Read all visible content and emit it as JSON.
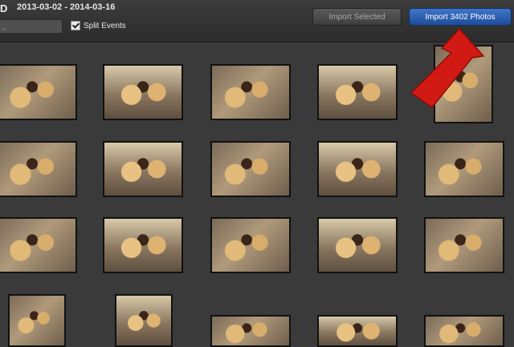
{
  "toolbar": {
    "title_fragment": "D",
    "date_range": "2013-03-02 - 2014-03-16",
    "search_fragment": "..",
    "split_events_label": "Split Events",
    "split_events_checked": true,
    "import_selected_label": "Import Selected",
    "import_all_label": "Import 3402 Photos"
  },
  "colors": {
    "import_all_accent": "#2a5fb4",
    "annotation_arrow": "#d11a14"
  },
  "annotation": {
    "icon": "red-arrow-icon"
  }
}
